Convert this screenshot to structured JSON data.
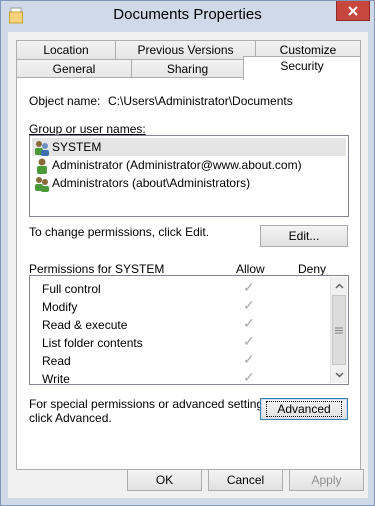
{
  "window": {
    "title": "Documents Properties",
    "close_icon": "close-icon",
    "title_icon": "folder-icon"
  },
  "tabs_back": [
    {
      "label": "Location"
    },
    {
      "label": "Previous Versions"
    },
    {
      "label": "Customize"
    }
  ],
  "tabs_front": [
    {
      "label": "General"
    },
    {
      "label": "Sharing"
    },
    {
      "label": "Security",
      "active": true
    }
  ],
  "security": {
    "object_name_label": "Object name:",
    "object_name_value": "C:\\Users\\Administrator\\Documents",
    "group_label": "Group or user names:",
    "users": [
      {
        "name": "SYSTEM",
        "selected": true,
        "icon": "users-group-icon"
      },
      {
        "name": "Administrator (Administrator@www.about.com)",
        "selected": false,
        "icon": "user-icon"
      },
      {
        "name": "Administrators (about\\Administrators)",
        "selected": false,
        "icon": "users-group-icon"
      }
    ],
    "change_text": "To change permissions, click Edit.",
    "edit_button": "Edit...",
    "permissions_label": "Permissions for SYSTEM",
    "allow_header": "Allow",
    "deny_header": "Deny",
    "permissions": [
      {
        "name": "Full control",
        "allow": true,
        "deny": false
      },
      {
        "name": "Modify",
        "allow": true,
        "deny": false
      },
      {
        "name": "Read & execute",
        "allow": true,
        "deny": false
      },
      {
        "name": "List folder contents",
        "allow": true,
        "deny": false
      },
      {
        "name": "Read",
        "allow": true,
        "deny": false
      },
      {
        "name": "Write",
        "allow": true,
        "deny": false
      }
    ],
    "advanced_text_line1": "For special permissions or advanced settings,",
    "advanced_text_line2": "click Advanced.",
    "advanced_button": "Advanced"
  },
  "footer": {
    "ok": "OK",
    "cancel": "Cancel",
    "apply": "Apply"
  }
}
